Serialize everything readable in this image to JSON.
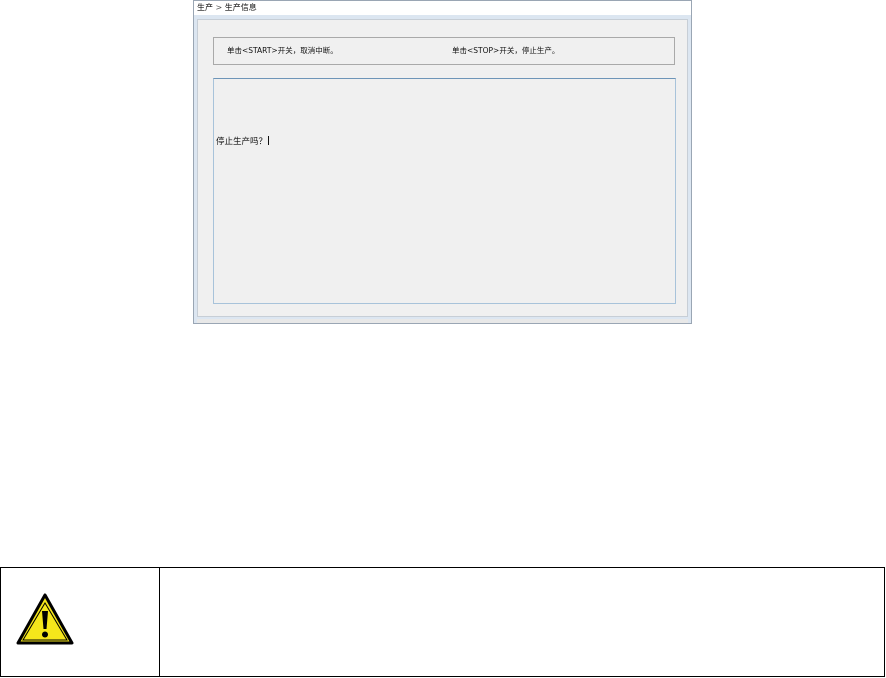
{
  "window": {
    "breadcrumb_root": "生产",
    "breadcrumb_separator": ">",
    "breadcrumb_current": "生产信息"
  },
  "hints": {
    "left": "单击<START>开关，取消中断。",
    "right": "单击<STOP>开关，停止生产。"
  },
  "message": {
    "text": "停止生产吗？"
  },
  "warning": {
    "icon": "warning-triangle-icon",
    "text": "",
    "colors": {
      "fill": "#f5e61b",
      "outline": "#000000"
    }
  }
}
